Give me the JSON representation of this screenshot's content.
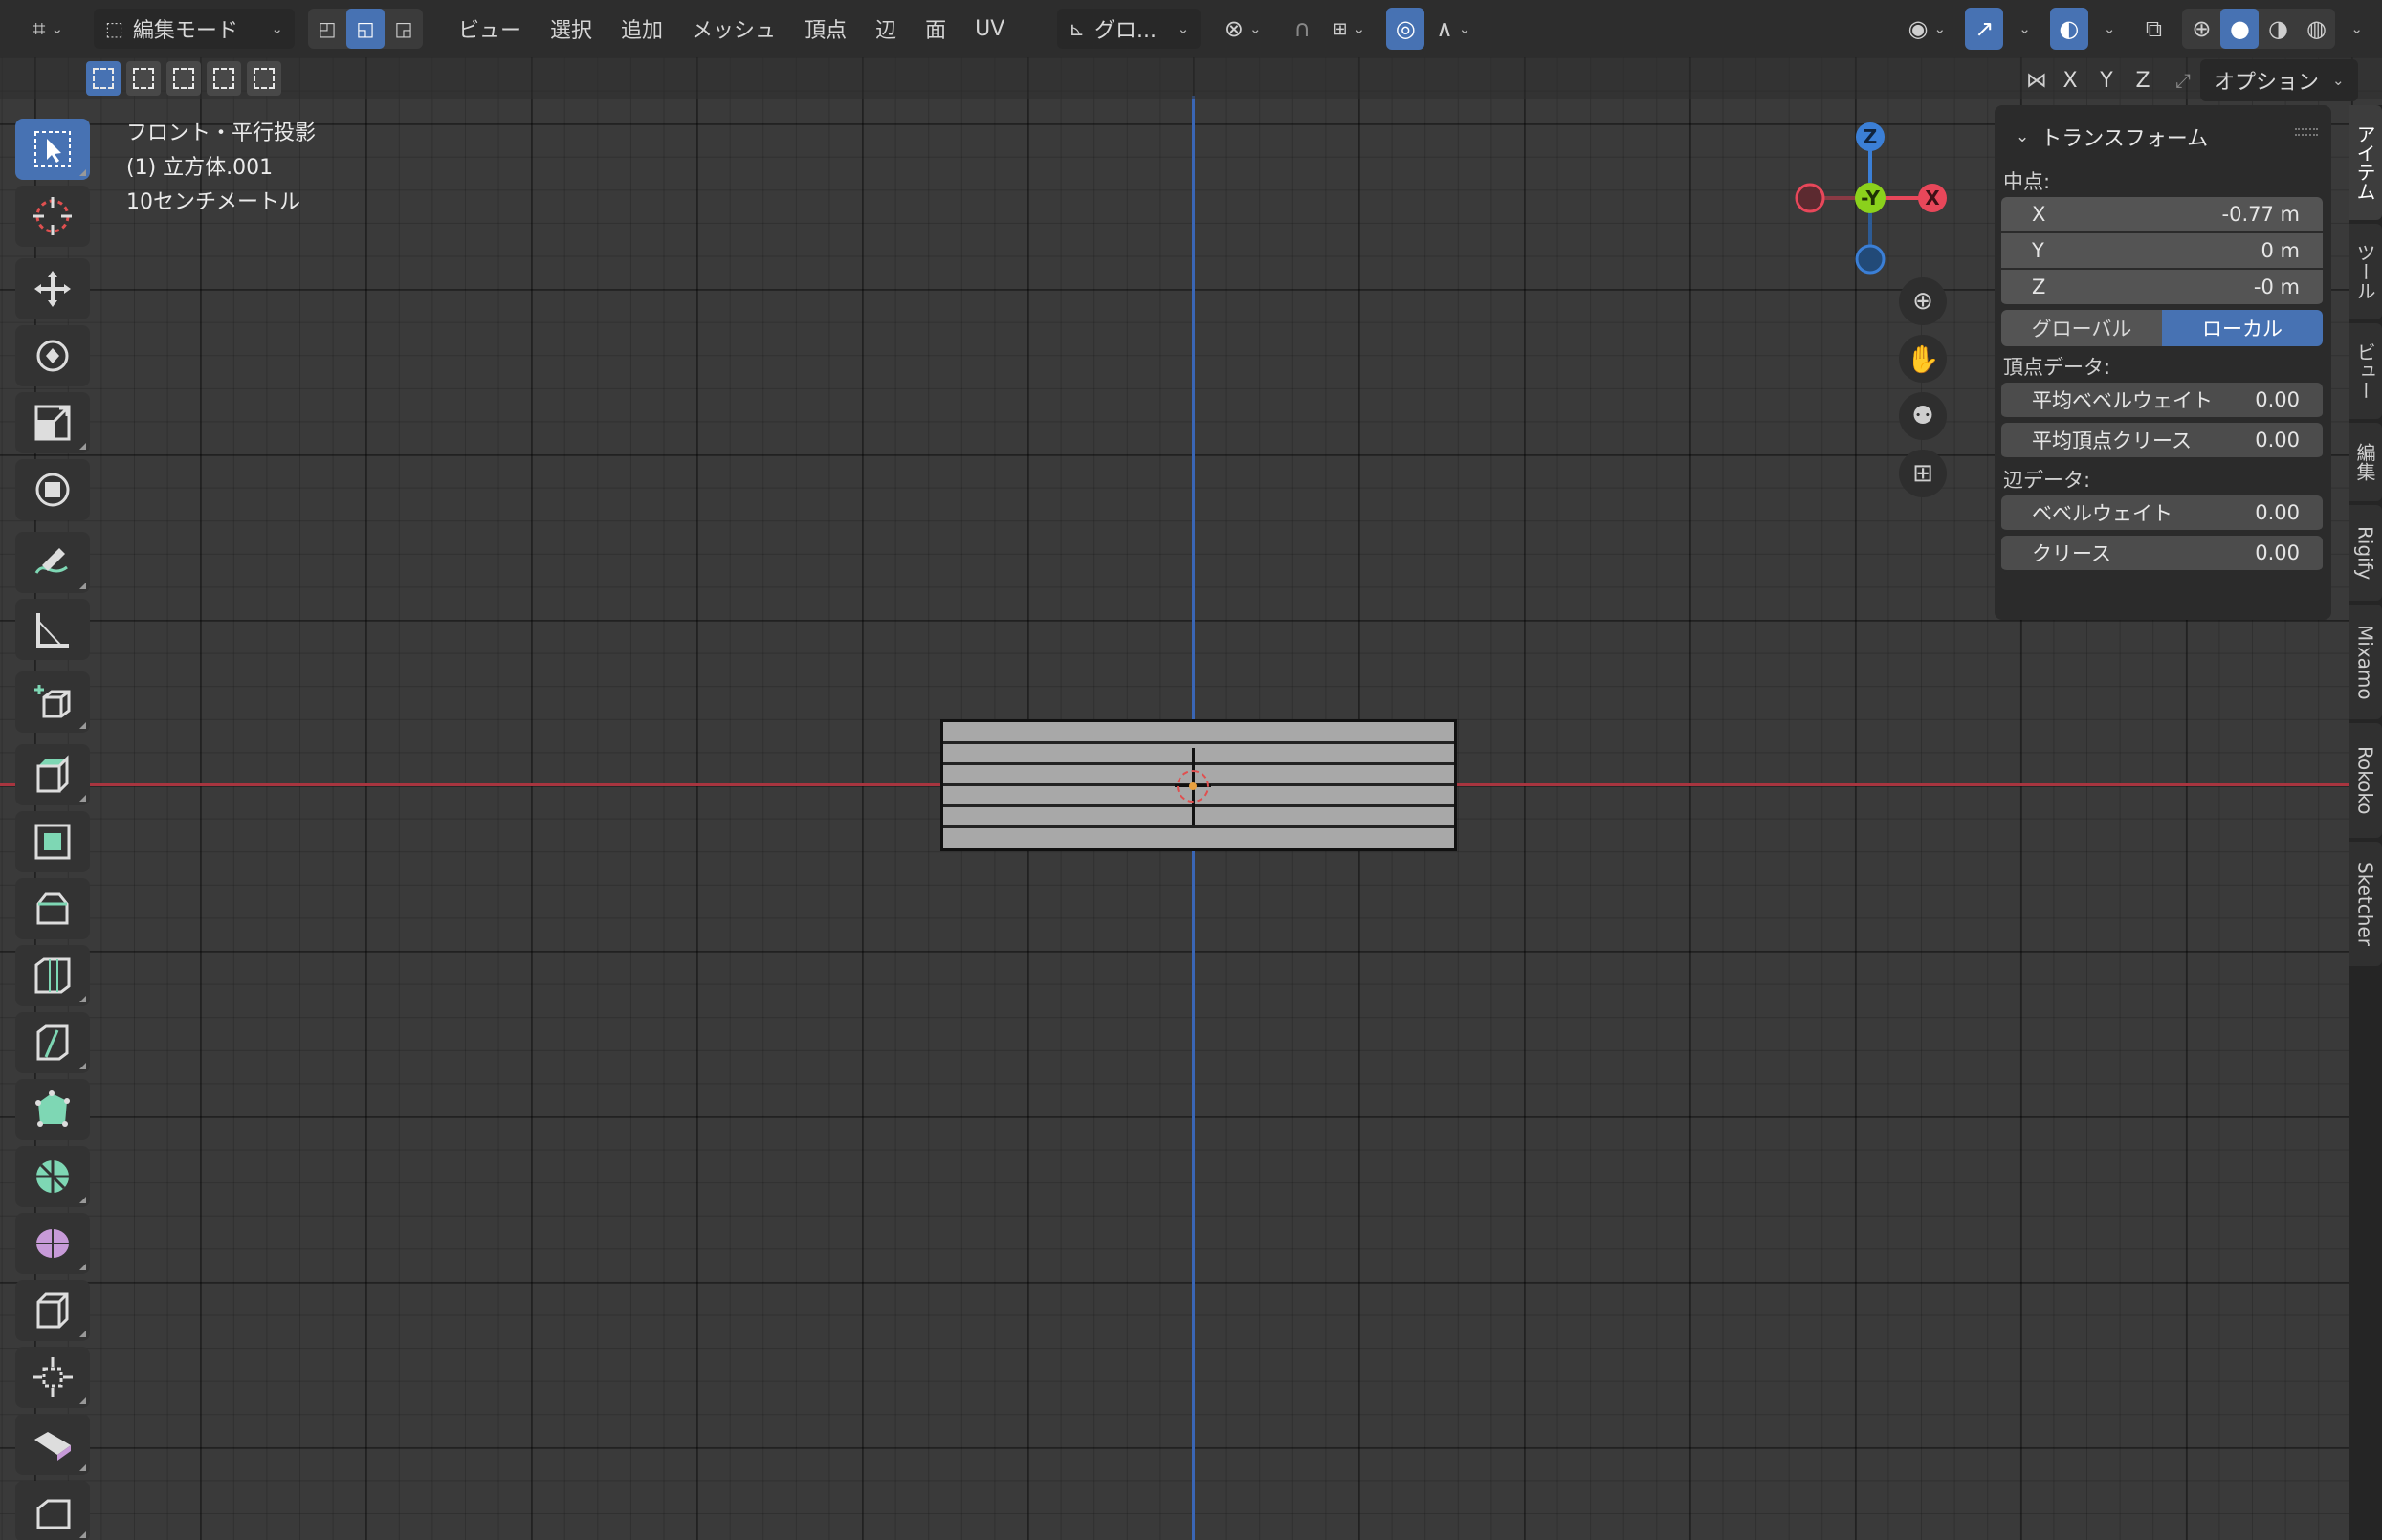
{
  "header": {
    "mode_label": "編集モード",
    "menus": [
      "ビュー",
      "選択",
      "追加",
      "メッシュ",
      "頂点",
      "辺",
      "面",
      "UV"
    ],
    "transform_orientation": "グロ..."
  },
  "axis_lock": {
    "x": "X",
    "y": "Y",
    "z": "Z"
  },
  "options_label": "オプション",
  "overlay": {
    "view_name": "フロント・平行投影",
    "object_name": "(1) 立方体.001",
    "scale": "10センチメートル"
  },
  "gizmo": {
    "z": "Z",
    "y": "-Y",
    "x": "X"
  },
  "npanel": {
    "title": "トランスフォーム",
    "median_label": "中点:",
    "x_label": "X",
    "x_value": "-0.77 m",
    "y_label": "Y",
    "y_value": "0 m",
    "z_label": "Z",
    "z_value": "-0 m",
    "global_label": "グローバル",
    "local_label": "ローカル",
    "vertex_data_label": "頂点データ:",
    "mean_bevel_weight_label": "平均ベベルウェイト",
    "mean_bevel_weight_value": "0.00",
    "mean_vertex_crease_label": "平均頂点クリース",
    "mean_vertex_crease_value": "0.00",
    "edge_data_label": "辺データ:",
    "bevel_weight_label": "ベベルウェイト",
    "bevel_weight_value": "0.00",
    "crease_label": "クリース",
    "crease_value": "0.00"
  },
  "sidetabs": [
    "アイテム",
    "ツール",
    "ビュー",
    "編集",
    "Rigify",
    "Mixamo",
    "Rokoko",
    "Sketcher"
  ],
  "colors": {
    "accent": "#4772b3",
    "axis_x": "#e8475a",
    "axis_y": "#8bd11c",
    "axis_z": "#3b7fd6"
  }
}
